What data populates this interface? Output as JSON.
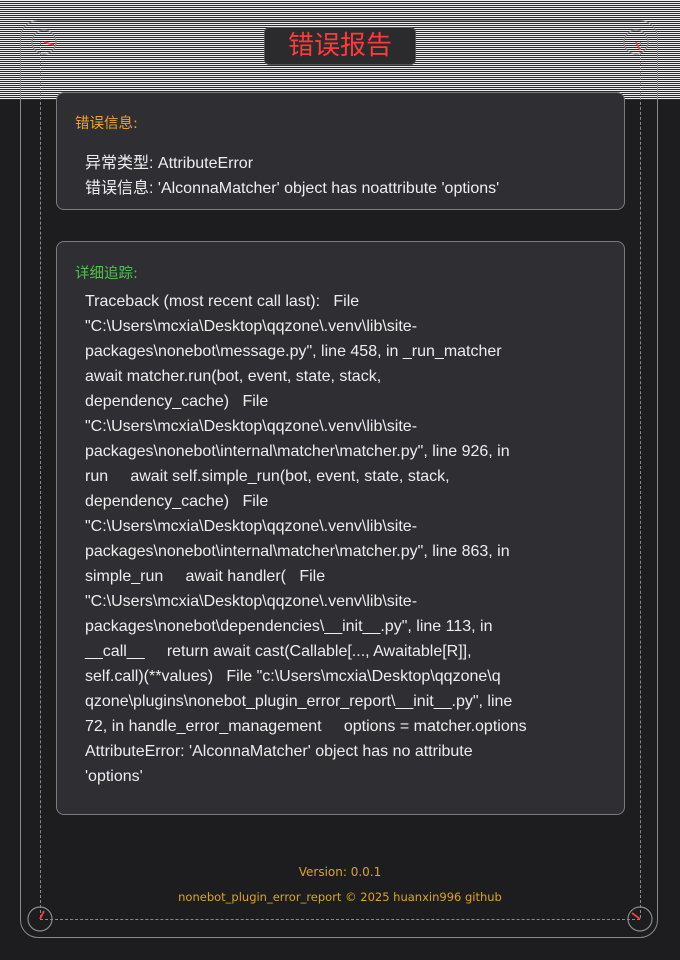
{
  "header": {
    "title": "错误报告"
  },
  "error_panel": {
    "heading": "错误信息:",
    "type_line": "异常类型: AttributeError",
    "message_line": "错误信息: 'AlconnaMatcher' object has noattribute 'options'"
  },
  "trace_panel": {
    "heading": "详细追踪:",
    "lines": [
      "Traceback (most recent call last):   File",
      "\"C:\\Users\\mcxia\\Desktop\\qqzone\\.venv\\lib\\site-",
      "packages\\nonebot\\message.py\", line 458, in _run_matcher",
      "await matcher.run(bot, event, state, stack,",
      "dependency_cache)   File",
      "\"C:\\Users\\mcxia\\Desktop\\qqzone\\.venv\\lib\\site-",
      "packages\\nonebot\\internal\\matcher\\matcher.py\", line 926, in",
      "run     await self.simple_run(bot, event, state, stack,",
      "dependency_cache)   File",
      "\"C:\\Users\\mcxia\\Desktop\\qqzone\\.venv\\lib\\site-",
      "packages\\nonebot\\internal\\matcher\\matcher.py\", line 863, in",
      "simple_run     await handler(   File",
      "\"C:\\Users\\mcxia\\Desktop\\qqzone\\.venv\\lib\\site-",
      "packages\\nonebot\\dependencies\\__init__.py\", line 113, in",
      "__call__     return await cast(Callable[..., Awaitable[R]],",
      "self.call)(**values)   File \"c:\\Users\\mcxia\\Desktop\\qqzone\\q",
      "qzone\\plugins\\nonebot_plugin_error_report\\__init__.py\", line",
      "72, in handle_error_management     options = matcher.options",
      "AttributeError: 'AlconnaMatcher' object has no attribute",
      "'options'"
    ]
  },
  "footer": {
    "version": "Version: 0.0.1",
    "credit": "nonebot_plugin_error_report © 2025 huanxin996 github"
  },
  "colors": {
    "title": "#ff3a3a",
    "error_heading": "#f0a326",
    "trace_heading": "#4fc24f",
    "footer": "#d9a521",
    "corner_needle": "#ff3a3a"
  },
  "icons": {
    "corners": [
      "clock-dial-icon",
      "clock-dial-icon",
      "clock-dial-icon",
      "clock-dial-icon"
    ]
  }
}
